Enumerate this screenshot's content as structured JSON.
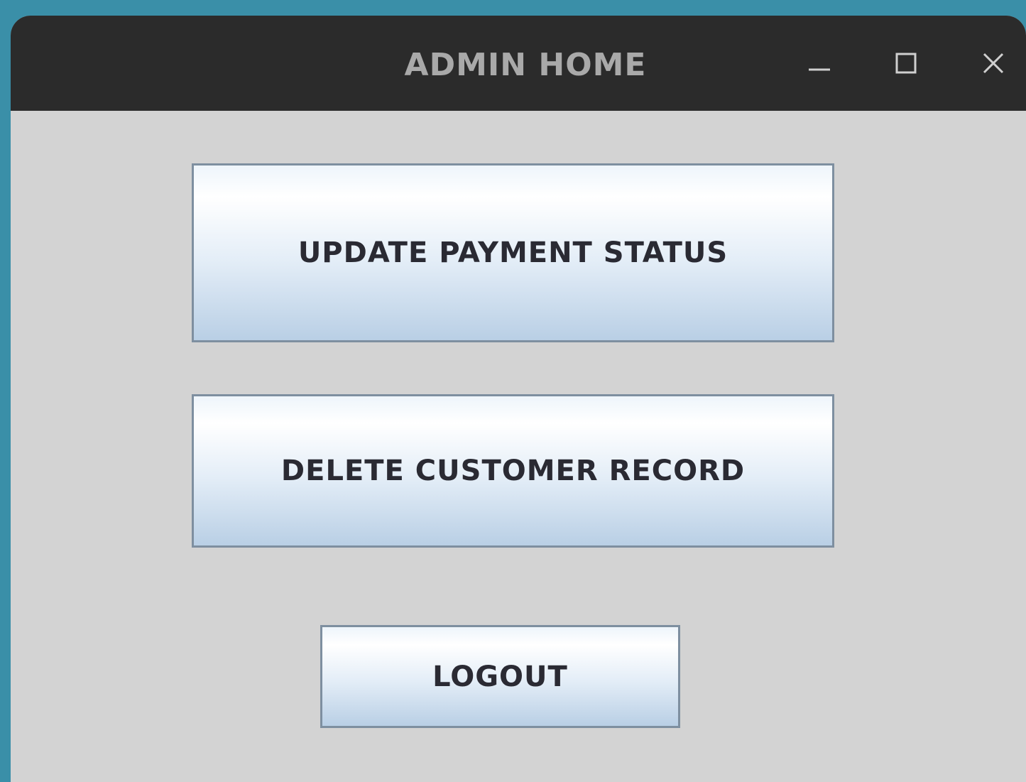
{
  "window": {
    "title": "ADMIN HOME",
    "controls": {
      "minimize_icon": "minimize-icon",
      "maximize_icon": "maximize-icon",
      "close_icon": "close-icon"
    }
  },
  "actions": {
    "update_payment_label": "UPDATE PAYMENT STATUS",
    "delete_customer_label": "DELETE CUSTOMER RECORD",
    "logout_label": "LOGOUT"
  },
  "colors": {
    "desktop": "#3a8fa8",
    "titlebar": "#2b2b2b",
    "title_text": "#a9a9a9",
    "window_bg": "#d3d3d3",
    "button_border": "#7e8fa0",
    "button_text": "#2a2a33"
  }
}
